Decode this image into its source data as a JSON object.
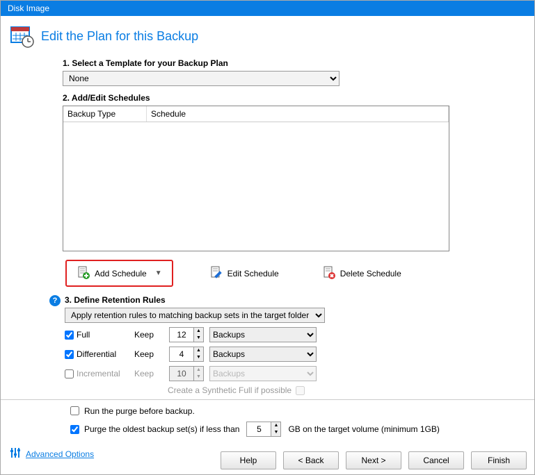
{
  "window": {
    "title": "Disk Image"
  },
  "page_title": "Edit the Plan for this Backup",
  "section1": {
    "label": "1. Select a Template for your Backup Plan",
    "template": "None"
  },
  "section2": {
    "label": "2. Add/Edit Schedules",
    "col1": "Backup Type",
    "col2": "Schedule",
    "add_label": "Add Schedule",
    "edit_label": "Edit Schedule",
    "delete_label": "Delete Schedule"
  },
  "section3": {
    "label": "3. Define Retention Rules",
    "apply_rule": "Apply retention rules to matching backup sets in the target folder",
    "full": {
      "label": "Full",
      "keep": "Keep",
      "value": "12",
      "unit": "Backups",
      "checked": true
    },
    "diff": {
      "label": "Differential",
      "keep": "Keep",
      "value": "4",
      "unit": "Backups",
      "checked": true
    },
    "inc": {
      "label": "Incremental",
      "keep": "Keep",
      "value": "10",
      "unit": "Backups",
      "checked": false
    },
    "synth": "Create a Synthetic Full if possible"
  },
  "run_purge": {
    "label": "Run the purge before backup.",
    "checked": false
  },
  "purge_oldest": {
    "label": "Purge the oldest backup set(s) if less than",
    "value": "5",
    "suffix": "GB on the target volume (minimum 1GB)",
    "checked": true
  },
  "advanced": "Advanced Options",
  "buttons": {
    "help": "Help",
    "back": "< Back",
    "next": "Next >",
    "cancel": "Cancel",
    "finish": "Finish"
  }
}
